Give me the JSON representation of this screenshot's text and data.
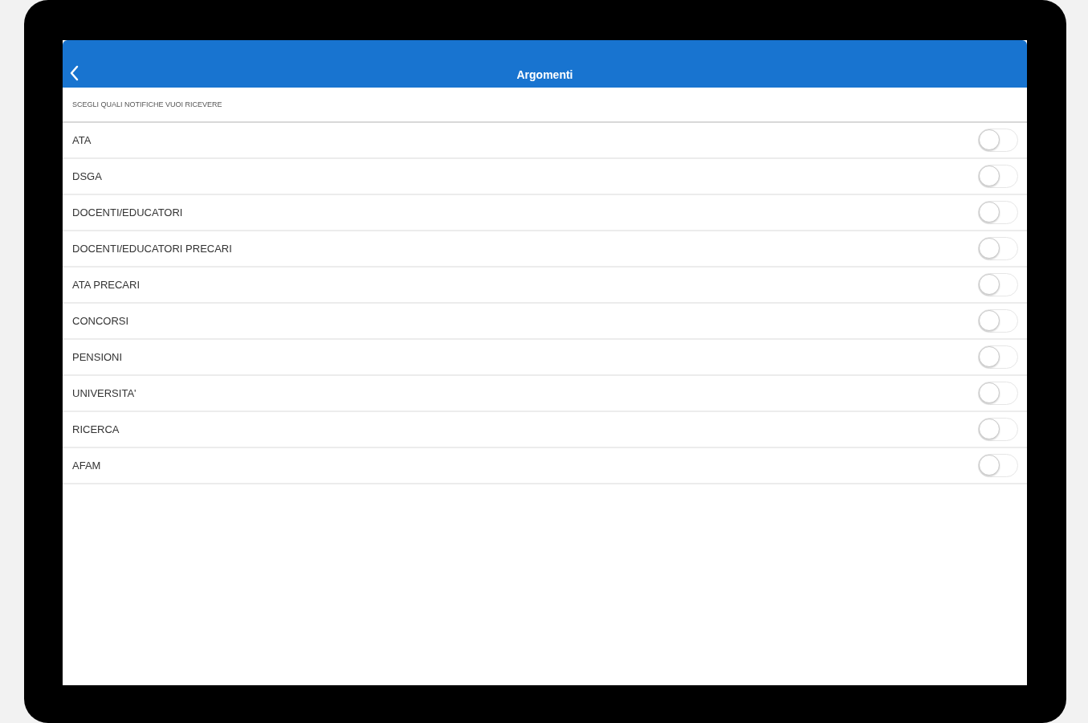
{
  "header": {
    "title": "Argomenti"
  },
  "section_label": "SCEGLI QUALI NOTIFICHE VUOI RICEVERE",
  "topics": [
    {
      "label": "ATA",
      "on": false
    },
    {
      "label": "DSGA",
      "on": false
    },
    {
      "label": "DOCENTI/EDUCATORI",
      "on": false
    },
    {
      "label": "DOCENTI/EDUCATORI PRECARI",
      "on": false
    },
    {
      "label": "ATA PRECARI",
      "on": false
    },
    {
      "label": "CONCORSI",
      "on": false
    },
    {
      "label": "PENSIONI",
      "on": false
    },
    {
      "label": "UNIVERSITA'",
      "on": false
    },
    {
      "label": "RICERCA",
      "on": false
    },
    {
      "label": "AFAM",
      "on": false
    }
  ]
}
